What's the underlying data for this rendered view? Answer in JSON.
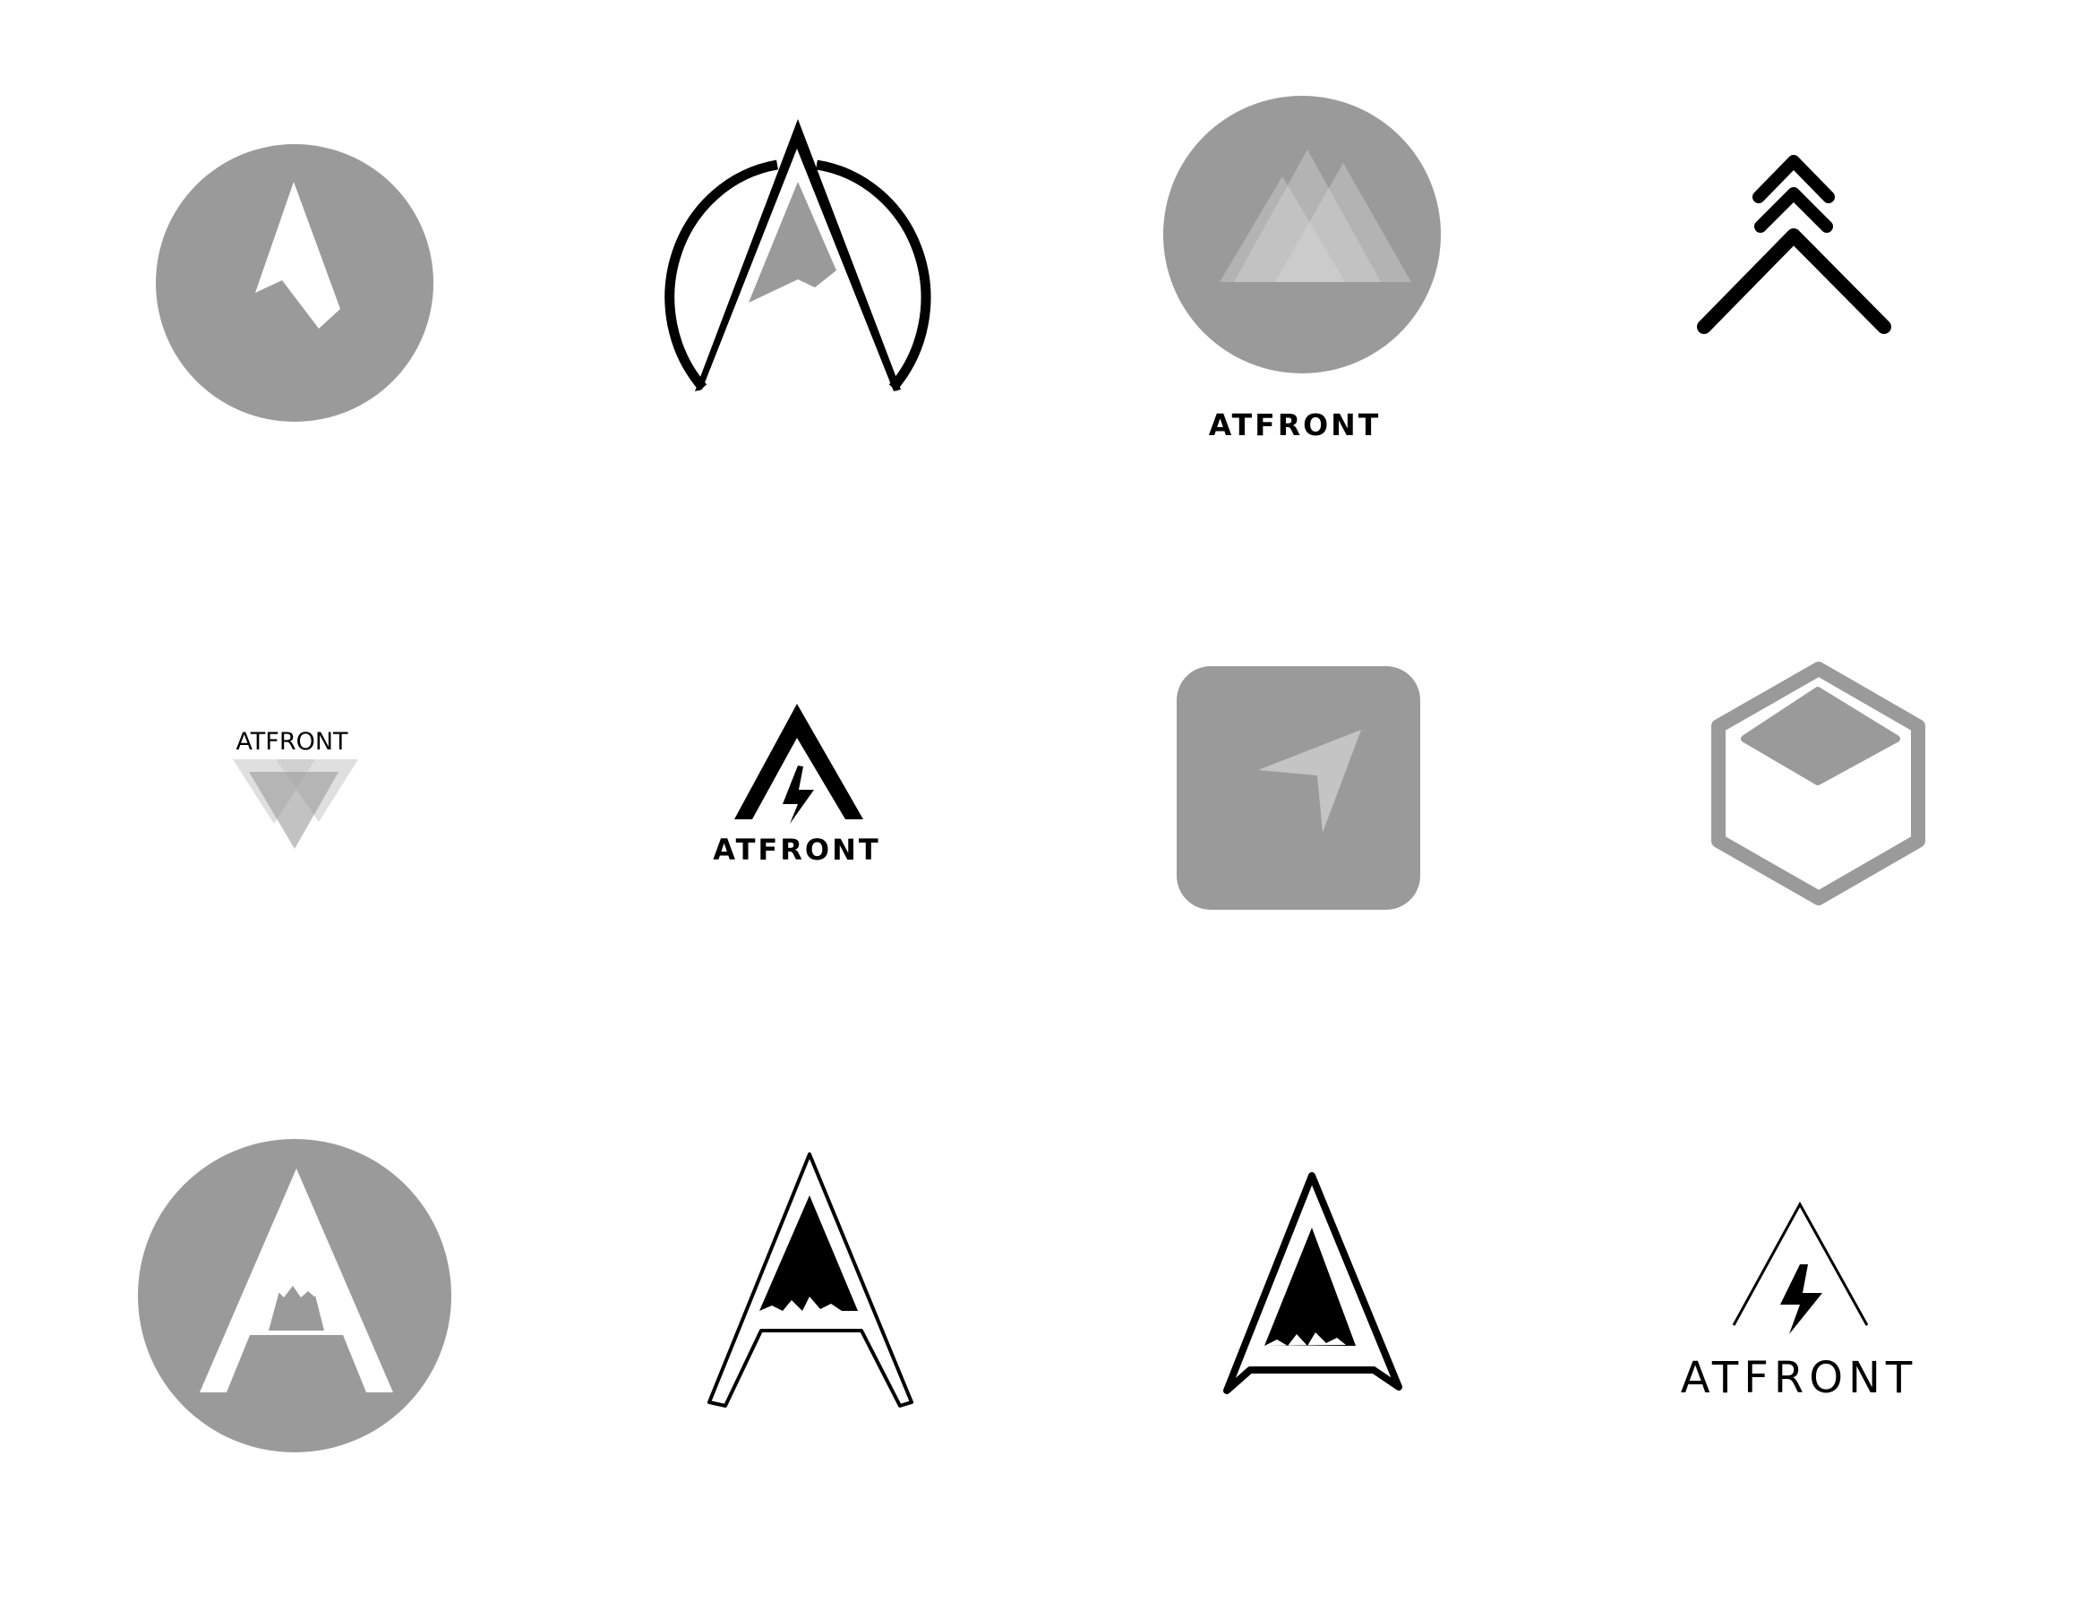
{
  "sheet": {
    "brand_name": "ATFRONT",
    "colors": {
      "background": "#ffffff",
      "ink": "#000000",
      "grey": "#9a9a9a",
      "light_grey": "#c4c4c4",
      "tint": "#d9d9d9"
    },
    "logos": [
      {
        "name": "circle-arrow-logo",
        "icon": "navigation-arrow-in-circle",
        "wordmark": ""
      },
      {
        "name": "outline-a-circle-logo",
        "icon": "letter-a-through-ring",
        "wordmark": ""
      },
      {
        "name": "mountains-circle-logo",
        "icon": "overlapping-mountains-in-circle",
        "wordmark": "ATFRONT"
      },
      {
        "name": "chevrons-logo",
        "icon": "stacked-up-chevrons",
        "wordmark": ""
      },
      {
        "name": "triangles-logo",
        "icon": "overlapping-inverted-triangles",
        "wordmark": "ATFRONT"
      },
      {
        "name": "bolt-a-logo",
        "icon": "letter-a-with-lightning-bolt",
        "wordmark": "ATFRONT"
      },
      {
        "name": "square-arrow-logo",
        "icon": "paper-plane-arrow-in-rounded-square",
        "wordmark": ""
      },
      {
        "name": "hexagon-logo",
        "icon": "hexagon-with-diamond",
        "wordmark": ""
      },
      {
        "name": "circle-a-logo",
        "icon": "letter-a-peak-in-circle",
        "wordmark": ""
      },
      {
        "name": "double-line-a-logo",
        "icon": "double-outline-letter-a-peak",
        "wordmark": ""
      },
      {
        "name": "rounded-a-logo",
        "icon": "rounded-outline-letter-a-peak",
        "wordmark": ""
      },
      {
        "name": "thin-bolt-a-logo",
        "icon": "thin-a-with-lightning-bolt",
        "wordmark": "ATFRONT"
      }
    ]
  }
}
